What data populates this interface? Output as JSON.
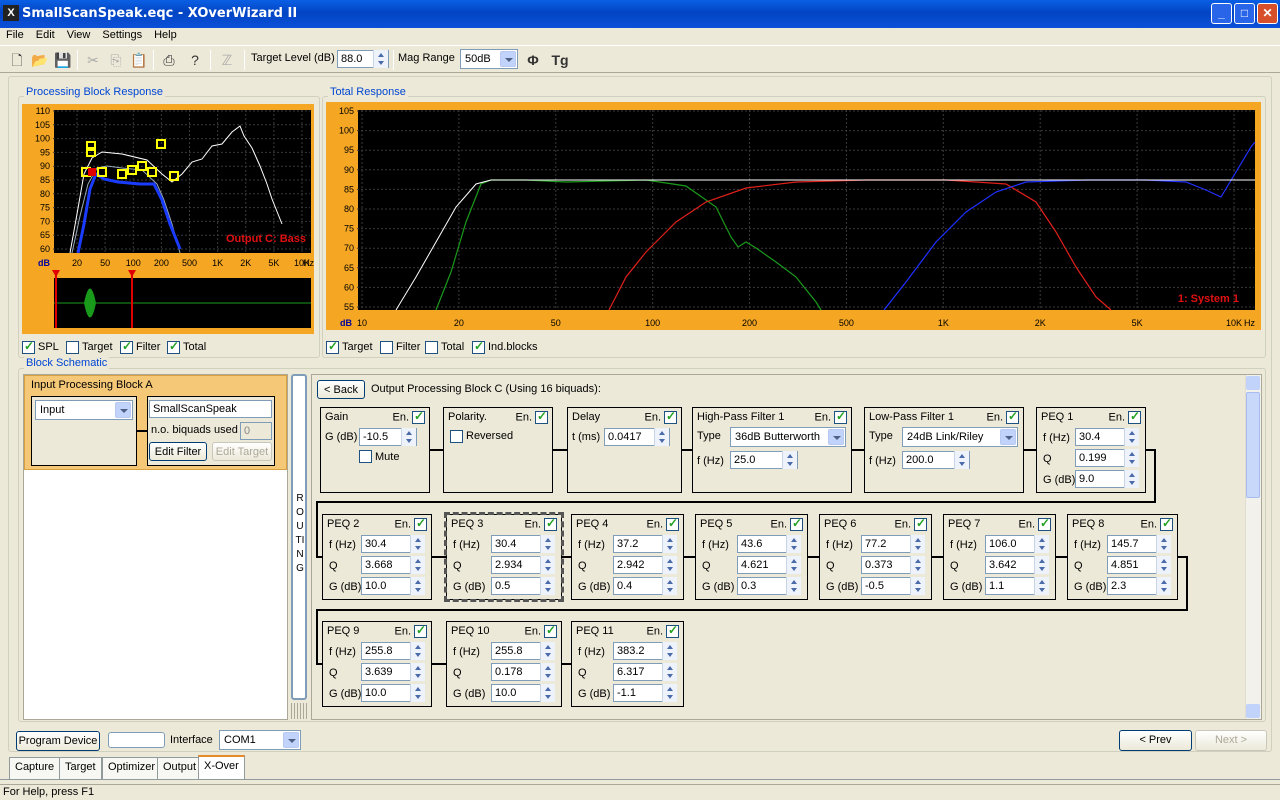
{
  "window": {
    "title": "SmallScanSpeak.eqc - XOverWizard II",
    "min": "_",
    "max": "□",
    "close": "✕"
  },
  "menu": [
    "File",
    "Edit",
    "View",
    "Settings",
    "Help"
  ],
  "toolbar": {
    "target_level_label": "Target Level (dB)",
    "target_level_value": "88.0",
    "mag_range_label": "Mag Range",
    "mag_range_value": "50dB",
    "phase_symbol": "Φ",
    "tg_symbol": "Tg"
  },
  "proc_block_response": {
    "title": "Processing Block Response",
    "overlay": "Output C: Bass",
    "db": "dB",
    "hz": "Hz",
    "y_ticks": [
      "110",
      "105",
      "100",
      "95",
      "90",
      "85",
      "80",
      "75",
      "70",
      "65",
      "60"
    ],
    "x_ticks": [
      "20",
      "50",
      "100",
      "200",
      "500",
      "1K",
      "2K",
      "5K",
      "10K"
    ],
    "checks": [
      {
        "label": "SPL",
        "on": true
      },
      {
        "label": "Target",
        "on": false
      },
      {
        "label": "Filter",
        "on": true
      },
      {
        "label": "Total",
        "on": true
      }
    ]
  },
  "total_response": {
    "title": "Total Response",
    "overlay": "1: System 1",
    "db": "dB",
    "hz": "Hz",
    "y_ticks": [
      "105",
      "100",
      "95",
      "90",
      "85",
      "80",
      "75",
      "70",
      "65",
      "60",
      "55"
    ],
    "x_ticks": [
      "10",
      "20",
      "50",
      "100",
      "200",
      "500",
      "1K",
      "2K",
      "5K",
      "10K"
    ],
    "checks": [
      {
        "label": "Target",
        "on": true
      },
      {
        "label": "Filter",
        "on": false
      },
      {
        "label": "Total",
        "on": false
      },
      {
        "label": "Ind.blocks",
        "on": true
      }
    ]
  },
  "block_schematic": {
    "title": "Block Schematic",
    "input_block_title": "Input Processing Block A",
    "input_select": "Input",
    "name_value": "SmallScanSpeak",
    "biquads_label": "n.o. biquads used",
    "biquads_value": "0",
    "edit_filter": "Edit Filter",
    "edit_target": "Edit Target",
    "routing": "ROUTING"
  },
  "output": {
    "back": "< Back",
    "title": "Output Processing Block C (Using 16 biquads):"
  },
  "gain": {
    "title": "Gain",
    "en": "En.",
    "label": "G (dB)",
    "value": "-10.5",
    "mute": "Mute"
  },
  "polarity": {
    "title": "Polarity.",
    "en": "En.",
    "reversed": "Reversed"
  },
  "delay": {
    "title": "Delay",
    "en": "En.",
    "label": "t (ms)",
    "value": "0.0417"
  },
  "hpf": {
    "title": "High-Pass Filter 1",
    "en": "En.",
    "type_label": "Type",
    "type_value": "36dB Butterworth",
    "f_label": "f (Hz)",
    "f_value": "25.0"
  },
  "lpf": {
    "title": "Low-Pass Filter 1",
    "en": "En.",
    "type_label": "Type",
    "type_value": "24dB Link/Riley",
    "f_label": "f (Hz)",
    "f_value": "200.0"
  },
  "peq_labels": {
    "en": "En.",
    "f": "f (Hz)",
    "q": "Q",
    "g": "G (dB)"
  },
  "peqs": [
    {
      "name": "PEQ 1",
      "f": "30.4",
      "q": "0.199",
      "g": "9.0"
    },
    {
      "name": "PEQ 2",
      "f": "30.4",
      "q": "3.668",
      "g": "10.0"
    },
    {
      "name": "PEQ 3",
      "f": "30.4",
      "q": "2.934",
      "g": "0.5"
    },
    {
      "name": "PEQ 4",
      "f": "37.2",
      "q": "2.942",
      "g": "0.4"
    },
    {
      "name": "PEQ 5",
      "f": "43.6",
      "q": "4.621",
      "g": "0.3"
    },
    {
      "name": "PEQ 6",
      "f": "77.2",
      "q": "0.373",
      "g": "-0.5"
    },
    {
      "name": "PEQ 7",
      "f": "106.0",
      "q": "3.642",
      "g": "1.1"
    },
    {
      "name": "PEQ 8",
      "f": "145.7",
      "q": "4.851",
      "g": "2.3"
    },
    {
      "name": "PEQ 9",
      "f": "255.8",
      "q": "3.639",
      "g": "10.0"
    },
    {
      "name": "PEQ 10",
      "f": "255.8",
      "q": "0.178",
      "g": "10.0"
    },
    {
      "name": "PEQ 11",
      "f": "383.2",
      "q": "6.317",
      "g": "-1.1"
    }
  ],
  "bottom": {
    "program_device": "Program Device",
    "interface_label": "Interface",
    "interface_value": "COM1",
    "prev": "< Prev",
    "next": "Next >"
  },
  "tabs": [
    "Capture",
    "Target",
    "Optimizer",
    "Output",
    "X-Over"
  ],
  "status": "For Help, press F1"
}
